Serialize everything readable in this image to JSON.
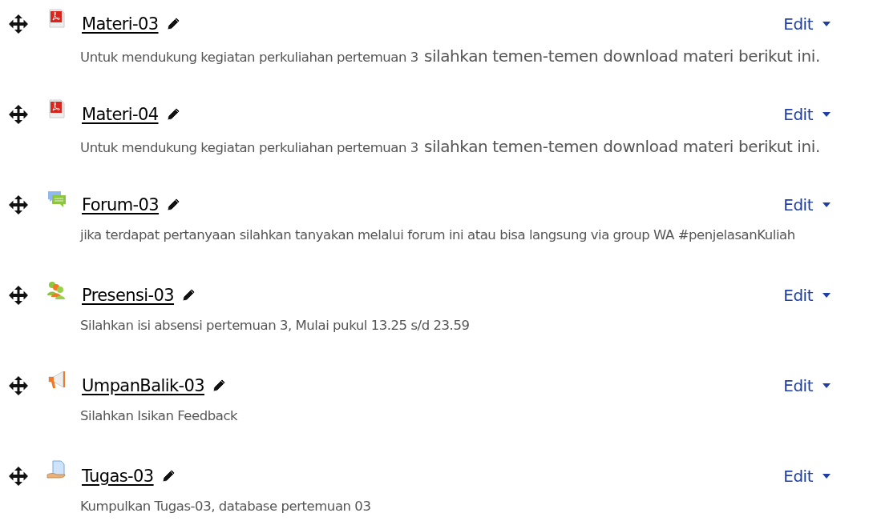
{
  "activities": [
    {
      "kind": "pdf",
      "title": "Materi-03",
      "edit_label": "Edit",
      "description": [
        {
          "kind": "plain",
          "text": "Untuk mendukung kegiatan perkuliahan pertemuan 3"
        },
        {
          "kind": "large",
          "text": "silahkan temen-temen download materi berikut ini."
        }
      ]
    },
    {
      "kind": "pdf",
      "title": "Materi-04",
      "edit_label": "Edit",
      "description": [
        {
          "kind": "plain",
          "text": "Untuk mendukung kegiatan perkuliahan pertemuan 3"
        },
        {
          "kind": "large",
          "text": "silahkan temen-temen download materi berikut ini."
        }
      ]
    },
    {
      "kind": "forum",
      "title": "Forum-03",
      "edit_label": "Edit",
      "description": [
        {
          "kind": "plain",
          "text": "jika terdapat pertanyaan silahkan tanyakan melalui forum ini atau bisa langsung via group WA #penjelasanKuliah"
        }
      ]
    },
    {
      "kind": "attendance",
      "title": "Presensi-03",
      "edit_label": "Edit",
      "description": [
        {
          "kind": "plain",
          "text": "Silahkan isi absensi pertemuan 3, Mulai pukul 13.25 s/d 23.59"
        }
      ]
    },
    {
      "kind": "feedback",
      "title": "UmpanBalik-03",
      "edit_label": "Edit",
      "description": [
        {
          "kind": "plain",
          "text": "Silahkan Isikan Feedback"
        }
      ]
    },
    {
      "kind": "assignment",
      "title": "Tugas-03",
      "edit_label": "Edit",
      "description": [
        {
          "kind": "plain",
          "text": "Kumpulkan Tugas-03, database pertemuan 03"
        }
      ]
    }
  ]
}
